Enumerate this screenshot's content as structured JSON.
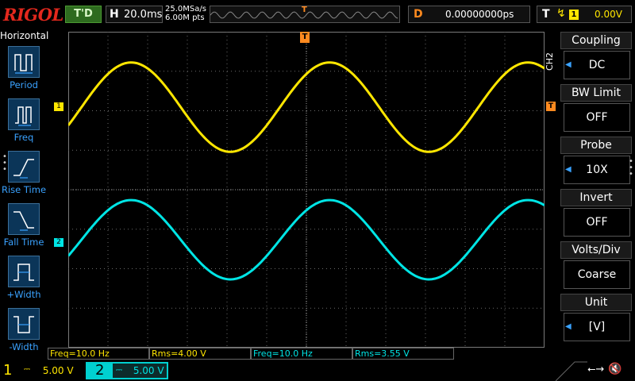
{
  "topbar": {
    "logo": "RIGOL",
    "run_status": "T'D",
    "horizontal": {
      "label": "H",
      "timebase": "20.0ms"
    },
    "sample_rate": "25.0MSa/s",
    "memory_depth": "6.00M pts",
    "trigger_marker": "T",
    "delay": {
      "label": "D",
      "value": "0.00000000ps"
    },
    "trigger": {
      "label": "T",
      "source": "1",
      "level": "0.00V"
    }
  },
  "left_menu": {
    "title": "Horizontal",
    "items": [
      {
        "label": "Period",
        "icon": "period-icon"
      },
      {
        "label": "Freq",
        "icon": "frequency-icon"
      },
      {
        "label": "Rise Time",
        "icon": "rise-time-icon"
      },
      {
        "label": "Fall Time",
        "icon": "fall-time-icon"
      },
      {
        "label": "+Width",
        "icon": "positive-width-icon"
      },
      {
        "label": "-Width",
        "icon": "negative-width-icon"
      }
    ]
  },
  "markers": {
    "ch1": "1",
    "ch2": "2",
    "trigger_level": "T"
  },
  "right_menu": {
    "channel_tag": "CH2",
    "items": [
      {
        "title": "Coupling",
        "value": "DC",
        "arrow": true
      },
      {
        "title": "BW Limit",
        "value": "OFF",
        "arrow": false
      },
      {
        "title": "Probe",
        "value": "10X",
        "arrow": true
      },
      {
        "title": "Invert",
        "value": "OFF",
        "arrow": false
      },
      {
        "title": "Volts/Div",
        "value": "Coarse",
        "arrow": false
      },
      {
        "title": "Unit",
        "value": "[V]",
        "arrow": true
      }
    ]
  },
  "measurements": [
    {
      "text": "Freq=10.0 Hz",
      "channel": 1
    },
    {
      "text": "Rms=4.00 V",
      "channel": 1
    },
    {
      "text": "Freq=10.0 Hz",
      "channel": 2
    },
    {
      "text": "Rms=3.55 V",
      "channel": 2
    }
  ],
  "bottom": {
    "ch1": {
      "num": "1",
      "coupling_icon": "dc-coupling-icon",
      "scale": "5.00 V"
    },
    "ch2": {
      "num": "2",
      "coupling_icon": "dc-coupling-icon",
      "scale": "5.00 V"
    },
    "usb_icon": "usb-icon",
    "sound_icon": "speaker-muted-icon"
  },
  "colors": {
    "ch1": "#ffe600",
    "ch2": "#00e5e5",
    "trigger": "#ff8a1f",
    "menu_label": "#3aa2ff",
    "logo": "#e3281d"
  },
  "waveforms": {
    "ch1": {
      "frequency_hz": 10.0,
      "rms_v": 4.0,
      "volts_per_div": 5.0
    },
    "ch2": {
      "frequency_hz": 10.0,
      "rms_v": 3.55,
      "volts_per_div": 5.0
    },
    "timebase_s_per_div": 0.02
  }
}
